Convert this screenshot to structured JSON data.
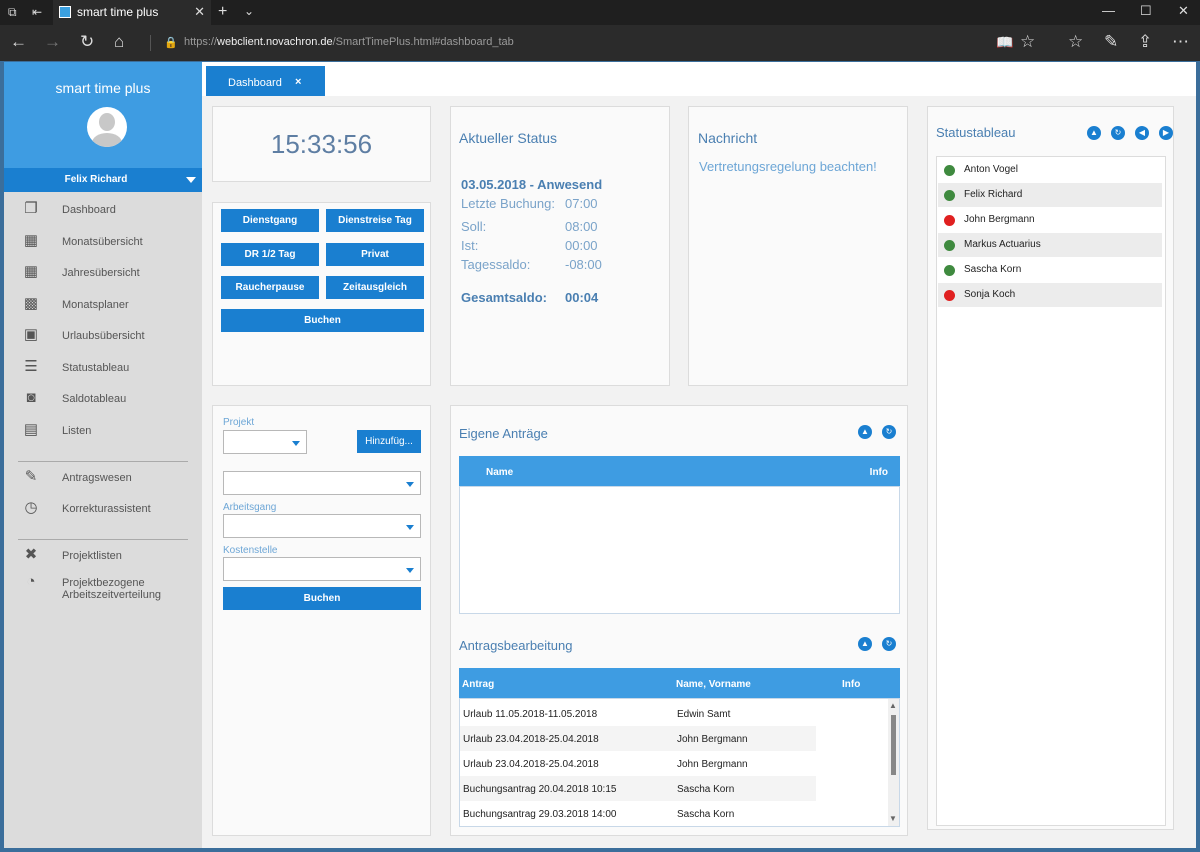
{
  "browser": {
    "tab_title": "smart time plus",
    "url_prefix": "https://",
    "url_host": "webclient.novachron.de",
    "url_path": "/SmartTimePlus.html#dashboard_tab"
  },
  "sidebar": {
    "brand": "smart time plus",
    "user_name": "Felix Richard",
    "items": [
      {
        "label": "Dashboard",
        "icon": "dashboard-icon"
      },
      {
        "label": "Monatsübersicht",
        "icon": "calendar-month-icon"
      },
      {
        "label": "Jahresübersicht",
        "icon": "calendar-year-icon"
      },
      {
        "label": "Monatsplaner",
        "icon": "planner-icon"
      },
      {
        "label": "Urlaubsübersicht",
        "icon": "vacation-icon"
      },
      {
        "label": "Statustableau",
        "icon": "list-icon"
      },
      {
        "label": "Saldotableau",
        "icon": "balance-icon"
      },
      {
        "label": "Listen",
        "icon": "document-list-icon"
      },
      {
        "label": "Antragswesen",
        "icon": "edit-icon"
      },
      {
        "label": "Korrekturassistent",
        "icon": "clock-icon"
      },
      {
        "label": "Projektlisten",
        "icon": "tools-icon"
      },
      {
        "label": "Projektbezogene",
        "label2": "Arbeitszeitverteilung",
        "icon": "project-time-icon"
      }
    ]
  },
  "content_tab": {
    "label": "Dashboard",
    "close": "×"
  },
  "clock": {
    "time": "15:33:56"
  },
  "actions": {
    "dienstgang": "Dienstgang",
    "dienstreise": "Dienstreise Tag",
    "dr_half": "DR 1/2 Tag",
    "privat": "Privat",
    "raucherpause": "Raucherpause",
    "zeitausgleich": "Zeitausgleich",
    "buchen": "Buchen"
  },
  "status": {
    "title": "Aktueller Status",
    "date_line": "03.05.2018 - Anwesend",
    "last_booking_label": "Letzte Buchung:",
    "last_booking_value": "07:00",
    "soll_label": "Soll:",
    "soll_value": "08:00",
    "ist_label": "Ist:",
    "ist_value": "00:00",
    "tagessaldo_label": "Tagessaldo:",
    "tagessaldo_value": "-08:00",
    "gesamtsaldo_label": "Gesamtsaldo:",
    "gesamtsaldo_value": "00:04"
  },
  "message": {
    "title": "Nachricht",
    "text": "Vertretungsregelung beachten!"
  },
  "statustableau": {
    "title": "Statustableau",
    "people": [
      {
        "name": "Anton Vogel",
        "status_color": "#3f8a3f"
      },
      {
        "name": "Felix Richard",
        "status_color": "#3f8a3f"
      },
      {
        "name": "John Bergmann",
        "status_color": "#e02020"
      },
      {
        "name": "Markus Actuarius",
        "status_color": "#3f8a3f"
      },
      {
        "name": "Sascha Korn",
        "status_color": "#3f8a3f"
      },
      {
        "name": "Sonja Koch",
        "status_color": "#e02020"
      }
    ]
  },
  "project": {
    "projekt_label": "Projekt",
    "add_button": "Hinzufüg...",
    "arbeitsgang_label": "Arbeitsgang",
    "kostenstelle_label": "Kostenstelle",
    "buchen": "Buchen"
  },
  "eigene_antraege": {
    "title": "Eigene Anträge",
    "col_name": "Name",
    "col_info": "Info"
  },
  "antragsbearbeitung": {
    "title": "Antragsbearbeitung",
    "col_antrag": "Antrag",
    "col_name": "Name, Vorname",
    "col_info": "Info",
    "rows": [
      {
        "antrag": "Urlaub 11.05.2018-11.05.2018",
        "name": "Edwin Samt"
      },
      {
        "antrag": "Urlaub 23.04.2018-25.04.2018",
        "name": "John Bergmann"
      },
      {
        "antrag": "Urlaub 23.04.2018-25.04.2018",
        "name": "John Bergmann"
      },
      {
        "antrag": "Buchungsantrag 20.04.2018 10:15",
        "name": "Sascha Korn"
      },
      {
        "antrag": "Buchungsantrag 29.03.2018 14:00",
        "name": "Sascha Korn"
      }
    ]
  }
}
